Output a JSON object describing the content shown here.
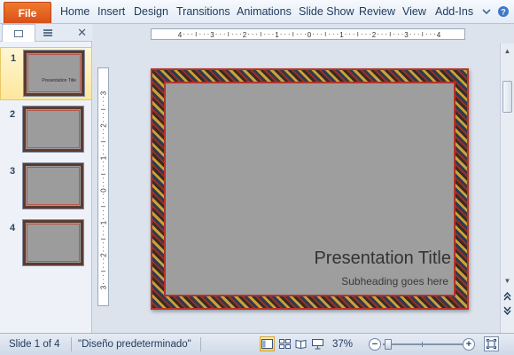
{
  "ribbon": {
    "file_label": "File",
    "tabs": [
      "Home",
      "Insert",
      "Design",
      "Transitions",
      "Animations",
      "Slide Show",
      "Review",
      "View",
      "Add-Ins"
    ]
  },
  "slide_panel": {
    "tab_slides_icon": "slides-icon",
    "tab_outline_icon": "outline-icon",
    "close_glyph": "✕",
    "slides": [
      {
        "number": "1",
        "title": "Presentation Title",
        "selected": true
      },
      {
        "number": "2"
      },
      {
        "number": "3"
      },
      {
        "number": "4"
      }
    ]
  },
  "rulers": {
    "horizontal_labels": [
      "4",
      "3",
      "2",
      "1",
      "0",
      "1",
      "2",
      "3",
      "4"
    ],
    "vertical_labels": [
      "3",
      "2",
      "1",
      "0",
      "1",
      "2",
      "3"
    ]
  },
  "slide": {
    "title": "Presentation Title",
    "subtitle": "Subheading goes here"
  },
  "statusbar": {
    "slide_indicator": "Slide 1 of 4",
    "theme_name": "\"Diseño predeterminado\"",
    "zoom": "37%"
  },
  "colors": {
    "file_tab": "#d8501a",
    "selected_thumb": "#fde79d",
    "slide_bg": "#9e9e9e",
    "frame_red": "#b2352c"
  }
}
